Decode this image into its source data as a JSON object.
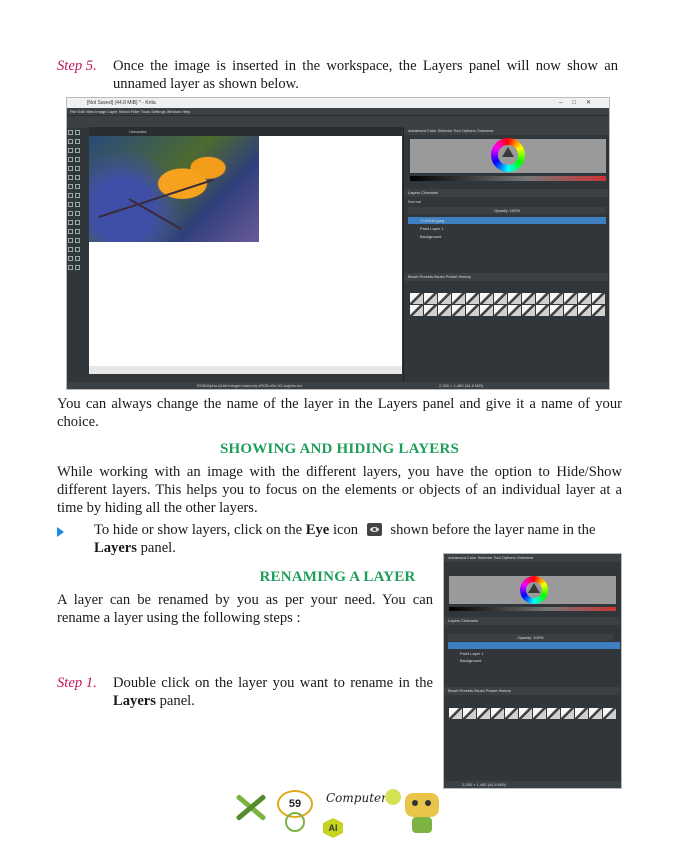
{
  "step5": {
    "label": "Step 5.",
    "text": "Once the image is inserted in the workspace, the Layers panel will now show an unnamed layer as shown below."
  },
  "krita": {
    "window_title": "[Not Saved] (44.8 MiB) * - Krita",
    "menu": "File  Edit  View  Image  Layer  Select  Filter  Tools  Settings  Window  Help",
    "tab_title": "Unnamed",
    "panel_tabs": "Advanced Color Selector    Tool Options    Overview",
    "layers_tabs": "Layers    Channels",
    "blending": "Normal",
    "opacity": "Opacity: 100%",
    "layers": [
      "1784948.jpeg",
      "Paint Layer 1",
      "Background"
    ],
    "presets_tabs": "Brush Presets    Brush Preset History",
    "status_left": "RGB/Alpha (8-bit integer/channel)  sRGB-elle-V2-srgbtrc.icc",
    "status_right": "2,260 × 1,480 (44.8 MiB)"
  },
  "para_rename_choice": "You can always change the name of the layer in the Layers panel and give it a name of your choice.",
  "heading_show_hide": "SHOWING AND HIDING LAYERS",
  "para_show_hide": "While working with an image with the different layers, you have the option to Hide/Show different layers. This helps you to focus on the elements or objects of an individual layer at a time by hiding all the other layers.",
  "bullet": {
    "pre": "To hide or show layers, click on the",
    "bold1": "Eye",
    "mid": "icon",
    "post": "shown before the layer name in the",
    "bold2": "Layers",
    "end": "panel."
  },
  "heading_rename": "RENAMING A LAYER",
  "para_rename": "A layer can be renamed by you as per your need. You can rename a layer using the following steps :",
  "step1": {
    "label": "Step 1.",
    "text_pre": "Double click on the layer you want to rename in the",
    "bold": "Layers",
    "text_post": "panel."
  },
  "krita2": {
    "layers": [
      "Paint Layer 1",
      "Background"
    ]
  },
  "footer": {
    "page_number": "59",
    "brand": "Computer-7",
    "badge": "AI"
  }
}
